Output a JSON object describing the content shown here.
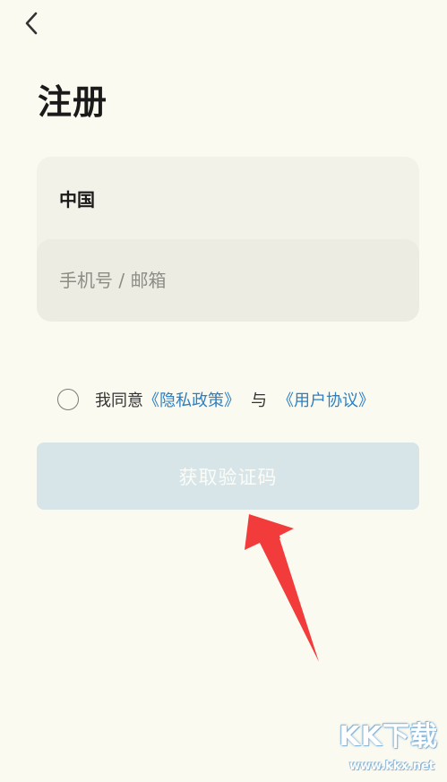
{
  "header": {
    "back_icon": "chevron-left-icon",
    "title": "注册"
  },
  "form": {
    "country": "中国",
    "account_placeholder": "手机号 / 邮箱",
    "account_value": ""
  },
  "agreement": {
    "checked": false,
    "prefix": "我同意",
    "privacy_link": "《隐私政策》",
    "conjunction": "与",
    "terms_link": "《用户协议》"
  },
  "submit": {
    "label": "获取验证码"
  },
  "watermark": {
    "logo": "KK下载",
    "url": "www.kkx.net"
  },
  "colors": {
    "background": "#fbfaf0",
    "card": "#f3f2e9",
    "input": "#edece2",
    "link": "#2b7fc3",
    "button_disabled": "#d7e5e8",
    "annotation_arrow": "#f23c3c"
  }
}
